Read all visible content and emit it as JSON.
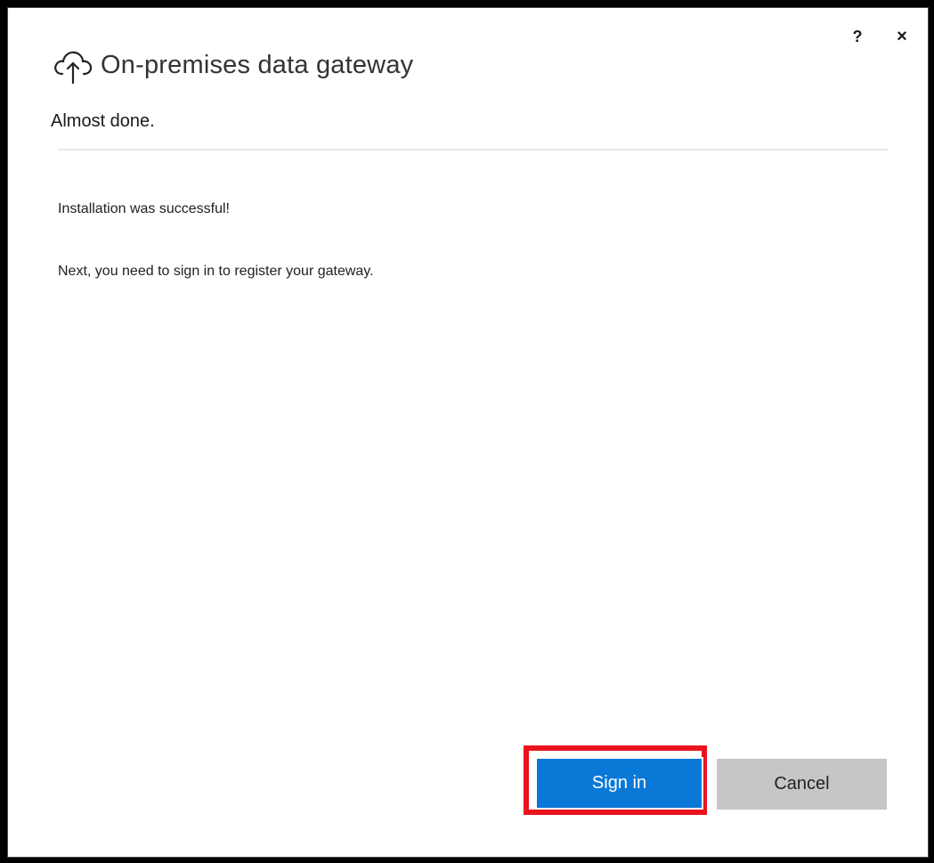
{
  "window": {
    "help_label": "?",
    "close_label": "×"
  },
  "header": {
    "icon": "cloud-upload-icon",
    "title": "On-premises data gateway"
  },
  "status": {
    "subtitle": "Almost done."
  },
  "content": {
    "message_success": "Installation was successful!",
    "message_next": "Next, you need to sign in to register your gateway."
  },
  "buttons": {
    "sign_in": "Sign in",
    "cancel": "Cancel"
  },
  "colors": {
    "primary": "#0a78d7",
    "secondary": "#c6c6c6",
    "highlight": "#e8141e"
  }
}
